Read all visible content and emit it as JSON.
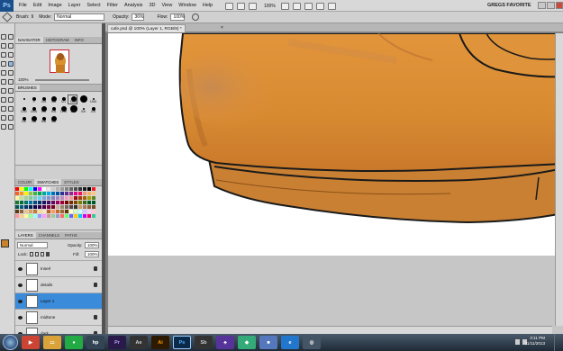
{
  "menubar": {
    "app_logo": "Ps",
    "menus": [
      "File",
      "Edit",
      "Image",
      "Layer",
      "Select",
      "Filter",
      "Analysis",
      "3D",
      "View",
      "Window",
      "Help"
    ],
    "zoom": "100%",
    "workspace": "GREGS FAVORITE"
  },
  "options": {
    "brush_label": "Brush:",
    "brush_size": "9",
    "mode_label": "Mode:",
    "mode_value": "Normal",
    "opacity_label": "Opacity:",
    "opacity_value": "36%",
    "flow_label": "Flow:",
    "flow_value": "100%"
  },
  "navigator": {
    "tabs": [
      "NAVIGATOR",
      "HISTOGRAM",
      "INFO"
    ],
    "zoom": "100%"
  },
  "brushes": {
    "tabs": [
      "BRUSHES"
    ],
    "sizes": [
      "",
      "9",
      "434",
      "345",
      "321",
      "1650",
      "",
      "1565",
      "1940",
      "1896",
      "900",
      "904",
      "1254",
      "250",
      "300",
      "200",
      "150",
      "256",
      "696",
      "300"
    ]
  },
  "swatches": {
    "tabs": [
      "COLOR",
      "SWATCHES",
      "STYLES"
    ],
    "colors": [
      "#ff0000",
      "#ffff00",
      "#00ff00",
      "#00ffff",
      "#0000ff",
      "#ff00ff",
      "#ffffff",
      "#e6e6e6",
      "#cccccc",
      "#b3b3b3",
      "#999999",
      "#808080",
      "#666666",
      "#4d4d4d",
      "#333333",
      "#1a1a1a",
      "#000000",
      "#ed1c24",
      "#f26522",
      "#f7941d",
      "#fff200",
      "#8dc63f",
      "#39b54a",
      "#00a651",
      "#00a99d",
      "#00aeef",
      "#0072bc",
      "#0054a6",
      "#2e3192",
      "#662d91",
      "#92278f",
      "#ec008c",
      "#ed145b",
      "#f69679",
      "#fbaf5d",
      "#fdc689",
      "#fff799",
      "#c4df9b",
      "#a3d39c",
      "#82ca9c",
      "#7accc8",
      "#6dcff6",
      "#7da7d9",
      "#8393ca",
      "#8781bd",
      "#a186be",
      "#bd8cbf",
      "#f49ac1",
      "#f5989d",
      "#9e0b0f",
      "#a0410d",
      "#a36209",
      "#aba000",
      "#598527",
      "#1a7b30",
      "#007236",
      "#00746b",
      "#0076a3",
      "#004b80",
      "#003471",
      "#1b1464",
      "#440e62",
      "#630460",
      "#9e005d",
      "#9e0039",
      "#790000",
      "#7b2e00",
      "#7d4900",
      "#827b00",
      "#406618",
      "#005e20",
      "#005826",
      "#005952",
      "#005b7f",
      "#003663",
      "#002157",
      "#0d004c",
      "#32004b",
      "#4b0049",
      "#7b0046",
      "#7a0026",
      "#c7b299",
      "#998675",
      "#736357",
      "#534741",
      "#372f2a",
      "#c69c6d",
      "#a67c52",
      "#8c6239",
      "#754c24",
      "#603913",
      "#8c6239",
      "#e8c291",
      "#d9a066",
      "#c07b3a",
      "#ffdd99",
      "#ffe4c4",
      "#b5651d",
      "#ff9966",
      "#cc6633",
      "#996633",
      "#663300",
      "#ffffcc",
      "#ccffcc",
      "#ccffff",
      "#ccccff",
      "#ffccff",
      "#ffcccc",
      "#ff9999",
      "#ffcc99",
      "#ffff99",
      "#99ff99",
      "#99ffff",
      "#9999ff",
      "#ff99ff",
      "#cc9999",
      "#99cc99",
      "#9999cc",
      "#ff6666",
      "#66ff66",
      "#6666ff",
      "#ffcc00",
      "#00ccff",
      "#cc00ff",
      "#ff0066",
      "#33cc99"
    ]
  },
  "layers": {
    "tabs": [
      "LAYERS",
      "CHANNELS",
      "PATHS"
    ],
    "blend": "Normal",
    "opacity_label": "Opacity:",
    "opacity_value": "100%",
    "lock_label": "Lock:",
    "fill_label": "Fill:",
    "fill_value": "100%",
    "items": [
      {
        "name": "Inserl",
        "selected": false
      },
      {
        "name": "details",
        "selected": false
      },
      {
        "name": "Layer 1",
        "selected": true
      },
      {
        "name": "midtone",
        "selected": false
      },
      {
        "name": "dark",
        "selected": false
      }
    ]
  },
  "document": {
    "tab_title": "cafe.psd @ 100% (Layer 1, RGB/8) *"
  },
  "taskbar": {
    "time": "3:11 PM",
    "date": "11/11/2013"
  }
}
